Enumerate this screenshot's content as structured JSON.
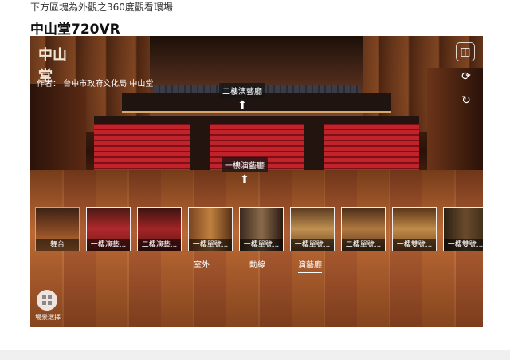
{
  "page": {
    "hint": "下方區塊為外觀之360度觀看環場",
    "title": "中山堂720VR"
  },
  "viewer": {
    "logo_text": "中山堂",
    "author": "作者： 台中市政府文化局 中山堂",
    "side_icons": [
      "vr-icon",
      "gyro-icon",
      "rotate-icon"
    ],
    "hotspots": [
      {
        "label": "二樓演藝廳"
      },
      {
        "label": "一樓演藝廳"
      }
    ],
    "thumbnails": [
      {
        "label": "舞台",
        "active": true
      },
      {
        "label": "一樓演藝..."
      },
      {
        "label": "二樓演藝..."
      },
      {
        "label": "一樓單號..."
      },
      {
        "label": "一樓單號..."
      },
      {
        "label": "一樓單號..."
      },
      {
        "label": "二樓單號..."
      },
      {
        "label": "一樓雙號..."
      },
      {
        "label": "一樓雙號..."
      }
    ],
    "tabs": [
      {
        "label": "室外"
      },
      {
        "label": "動線"
      },
      {
        "label": "演藝廳",
        "active": true
      }
    ],
    "scene_select_label": "場景選擇"
  }
}
